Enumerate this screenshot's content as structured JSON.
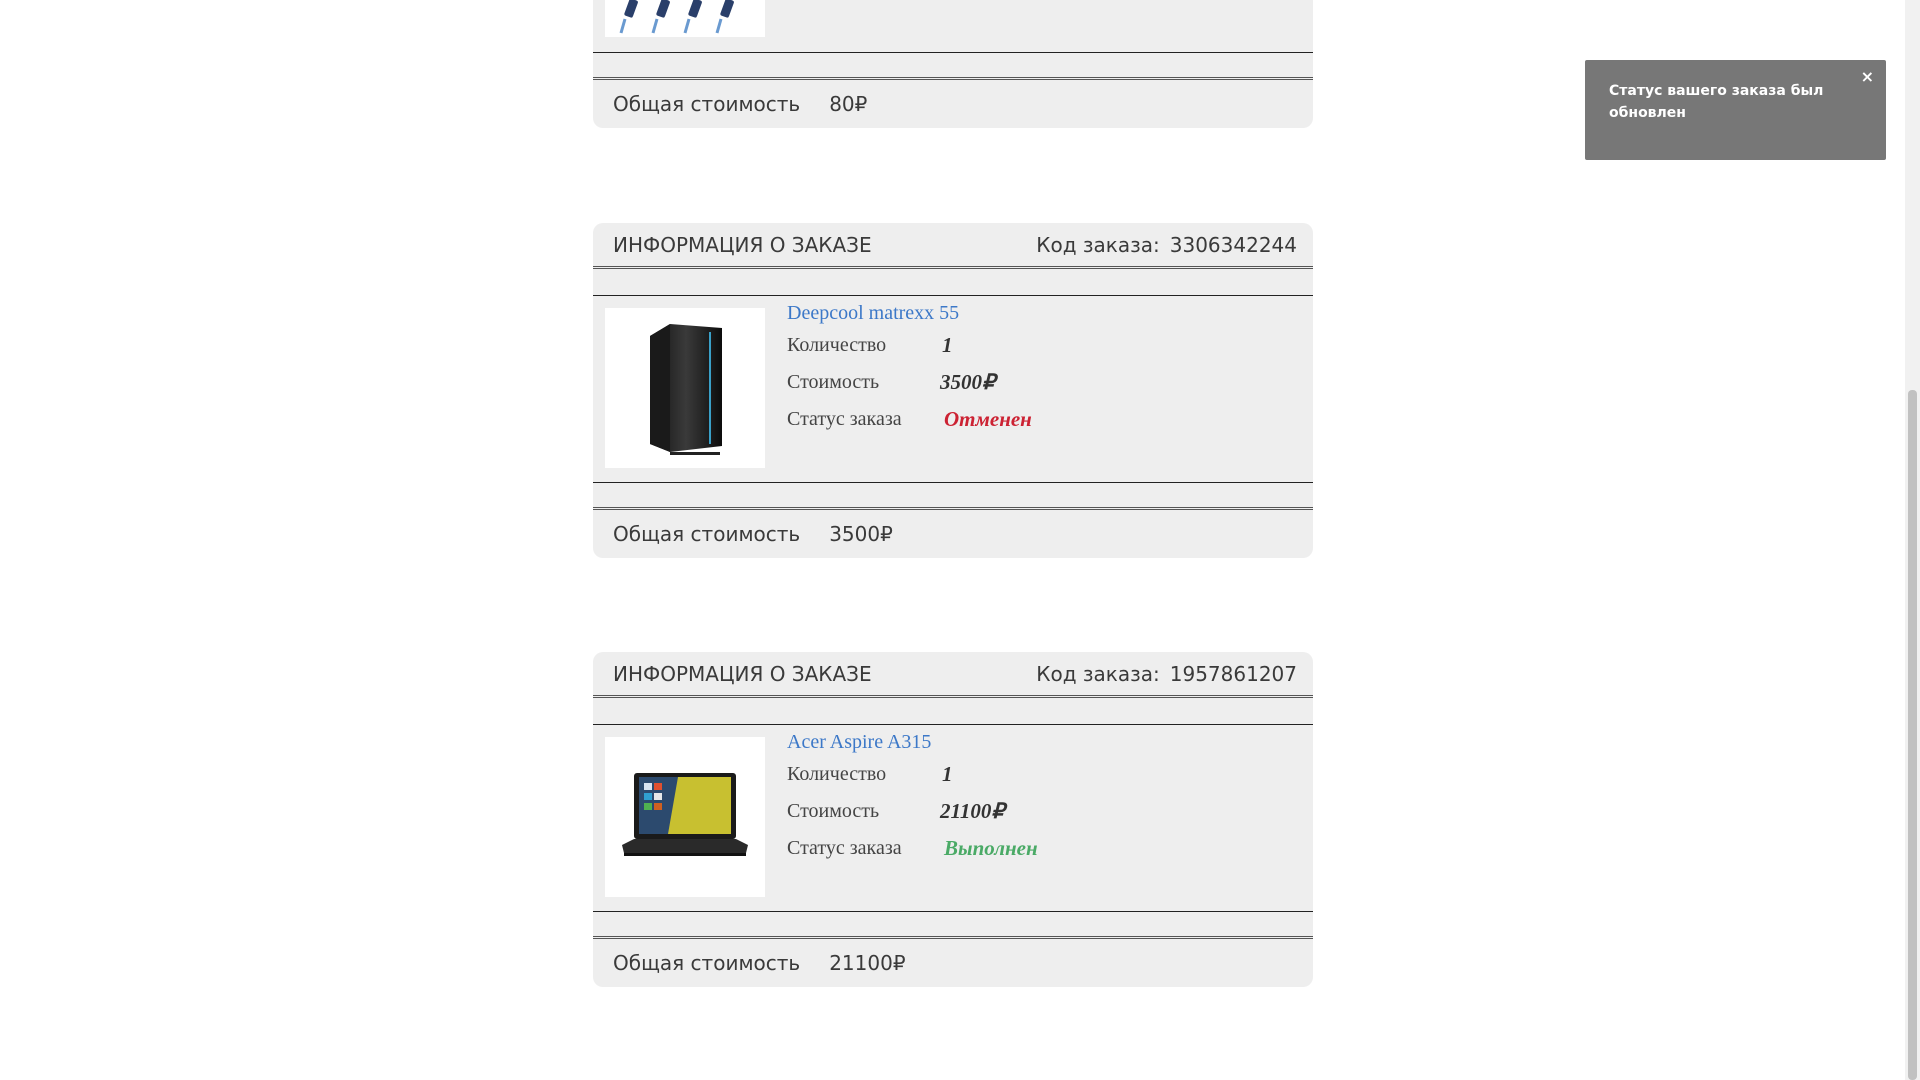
{
  "toast": {
    "message": "Статус вашего заказа был обновлен",
    "close": "×"
  },
  "labels": {
    "order_info": "ИНФОРМАЦИЯ О ЗАКАЗЕ",
    "order_code": "Код заказа:",
    "quantity": "Количество",
    "price": "Стоимость",
    "status": "Статус заказа",
    "total": "Общая стоимость"
  },
  "top_order": {
    "total": "80₽"
  },
  "orders": [
    {
      "code": "3306342244",
      "item": {
        "title": "Deepcool matrexx 55",
        "quantity": "1",
        "price": "3500₽",
        "status": "Отменен",
        "image_icon": "pc-case-image"
      },
      "total": "3500₽"
    },
    {
      "code": "1957861207",
      "item": {
        "title": "Acer Aspire A315",
        "quantity": "1",
        "price": "21100₽",
        "status": "Выполнен",
        "image_icon": "laptop-image"
      },
      "total": "21100₽"
    }
  ],
  "colors": {
    "status_cancelled": "#cc2233",
    "status_done": "#4aaa66",
    "link": "#3c78c8",
    "panel": "#eeeeee"
  }
}
